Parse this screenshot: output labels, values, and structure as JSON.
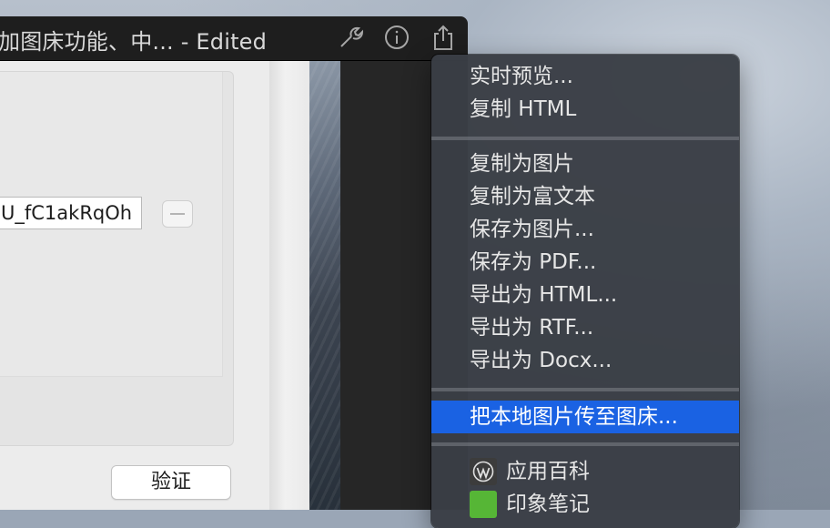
{
  "window": {
    "title": "加图床功能、中...  - Edited"
  },
  "settings": {
    "token_value": "U_fC1akRqOh",
    "verify_label": "验证"
  },
  "menu": {
    "group1": [
      "实时预览...",
      "复制 HTML"
    ],
    "group2": [
      "复制为图片",
      "复制为富文本",
      "保存为图片...",
      "保存为 PDF...",
      "导出为 HTML...",
      "导出为 RTF...",
      "导出为 Docx..."
    ],
    "group3": [
      "把本地图片传至图床..."
    ],
    "group4": [
      {
        "label": "应用百科",
        "icon": "wordpress-icon"
      },
      {
        "label": "印象笔记",
        "icon": "evernote-icon"
      }
    ]
  },
  "colors": {
    "highlight": "#1a62e3",
    "menu_bg": "#3a3e45",
    "titlebar_bg": "#1e1e1e"
  }
}
